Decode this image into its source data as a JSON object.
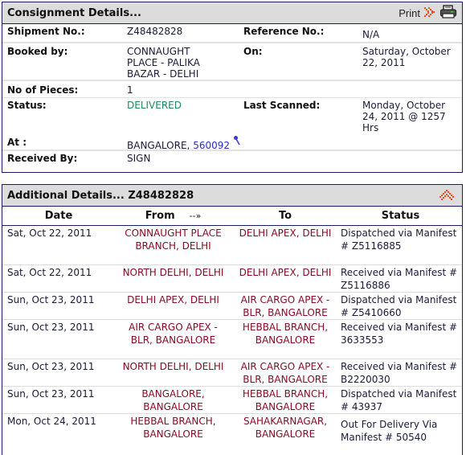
{
  "consignment": {
    "title": "Consignment Details...",
    "print_label": "Print",
    "fields": {
      "shipment_no_label": "Shipment No.:",
      "shipment_no": "Z48482828",
      "reference_no_label": "Reference No.:",
      "reference_no": "N/A",
      "booked_by_label": "Booked by:",
      "booked_by": "CONNAUGHT PLACE - PALIKA BAZAR - DELHI",
      "on_label": "On:",
      "on": "Saturday, October 22, 2011",
      "pieces_label": "No of Pieces:",
      "pieces": "1",
      "status_label": "Status:",
      "status": "DELIVERED",
      "last_scanned_label": "Last Scanned:",
      "last_scanned": "Monday, October 24, 2011 @ 1257 Hrs",
      "at_label": "At :",
      "at_city": "BANGALORE, ",
      "at_pin": "560092",
      "received_by_label": "Received By:",
      "received_by": "SIGN"
    },
    "colors": {
      "status_delivered": "#1f8a5a",
      "pin_link": "#2a2acc",
      "accent_arrow": "#ff4a1a"
    }
  },
  "additional": {
    "title": "Additional Details... Z48482828",
    "columns": {
      "date": "Date",
      "from": "From",
      "arrow": "--»",
      "to": "To",
      "status": "Status"
    },
    "rows": [
      {
        "date": "Sat, Oct 22, 2011",
        "from": "CONNAUGHT PLACE BRANCH, DELHI",
        "to": "DELHI APEX, DELHI",
        "status": "Dispatched via Manifest # Z5116885"
      },
      {
        "date": "Sat, Oct 22, 2011",
        "from": "NORTH DELHI, DELHI",
        "to": "DELHI APEX, DELHI",
        "status": "Received via Manifest # Z5116886"
      },
      {
        "date": "Sun, Oct 23, 2011",
        "from": "DELHI APEX, DELHI",
        "to": "AIR CARGO APEX - BLR, BANGALORE",
        "status": "Dispatched via Manifest # Z5410660"
      },
      {
        "date": "Sun, Oct 23, 2011",
        "from": "AIR CARGO APEX - BLR, BANGALORE",
        "to": "HEBBAL BRANCH, BANGALORE",
        "status": "Received via Manifest # 3633553"
      },
      {
        "date": "Sun, Oct 23, 2011",
        "from": "NORTH DELHI, DELHI",
        "to": "AIR CARGO APEX - BLR, BANGALORE",
        "status": "Received via Manifest # B2220030"
      },
      {
        "date": "Sun, Oct 23, 2011",
        "from": "BANGALORE, BANGALORE",
        "to": "HEBBAL BRANCH, BANGALORE",
        "status": "Dispatched via Manifest # 43937"
      },
      {
        "date": "Mon, Oct 24, 2011",
        "from": "HEBBAL BRANCH, BANGALORE",
        "to": "SAHAKARNAGAR, BANGALORE",
        "status": "Out For Delivery Via Manifest # 50540"
      }
    ]
  }
}
